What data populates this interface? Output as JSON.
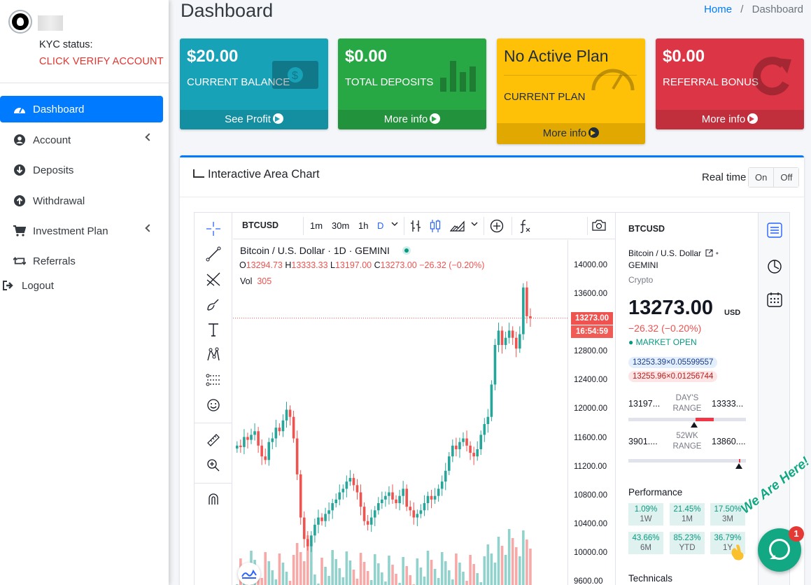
{
  "sidebar": {
    "kyc_label": "KYC status:",
    "kyc_link": "CLICK VERIFY ACCOUNT",
    "items": [
      {
        "label": "Dashboard"
      },
      {
        "label": "Account"
      },
      {
        "label": "Deposits"
      },
      {
        "label": "Withdrawal"
      },
      {
        "label": "Investment Plan"
      },
      {
        "label": "Referrals"
      },
      {
        "label": "Logout"
      }
    ]
  },
  "header": {
    "title": "Dashboard",
    "breadcrumb": [
      "Home",
      "/",
      "Dashboard"
    ]
  },
  "boxes": [
    {
      "value": "$20.00",
      "label": "CURRENT BALANCE",
      "footer": "See Profit",
      "color": "#17a2b8"
    },
    {
      "value": "$0.00",
      "label": "TOTAL DEPOSITS",
      "footer": "More info",
      "color": "#28a745"
    },
    {
      "value": "No Active Plan",
      "label": "CURRENT PLAN",
      "footer": "More info",
      "color": "#ffc107"
    },
    {
      "value": "$0.00",
      "label": "REFERRAL BONUS",
      "footer": "More info",
      "color": "#dc3545"
    }
  ],
  "card": {
    "title": "Interactive Area Chart",
    "realtime_label": "Real time",
    "on_label": "On",
    "off_label": "Off"
  },
  "tv": {
    "symbol": "BTCUSD",
    "intervals": [
      "1m",
      "30m",
      "1h",
      "D"
    ],
    "legend_title": "Bitcoin / U.S. Dollar · 1D · GEMINI",
    "ohlc": {
      "o_label": "O",
      "o": "13294.73",
      "h_label": "H",
      "h": "13333.33",
      "l_label": "L",
      "l": "13197.00",
      "c_label": "C",
      "c": "13273.00",
      "chg": "−26.32 (−0.20%)"
    },
    "vol_label": "Vol",
    "vol": "305",
    "price_ticks": [
      "14000.00",
      "13600.00",
      "13200.00",
      "12800.00",
      "12400.00",
      "12000.00",
      "11600.00",
      "11200.00",
      "10800.00",
      "10400.00",
      "10000.00",
      "9600.00"
    ],
    "last_price_tag": "13273.00",
    "countdown_tag": "16:54:59"
  },
  "symbol_info": {
    "symbol": "BTCUSD",
    "name": "Bitcoin / U.S. Dollar",
    "exchange": "GEMINI",
    "type": "Crypto",
    "price": "13273.00",
    "currency": "USD",
    "change": "−26.32 (−0.20%)",
    "market_status": "● MARKET OPEN",
    "bid": "13253.39×0.05599557",
    "ask": "13255.96×0.01256744",
    "days_range": {
      "low": "13197...",
      "label": "DAY'S RANGE",
      "high": "13333..."
    },
    "wk52_range": {
      "low": "3901....",
      "label": "52WK RANGE",
      "high": "13860...."
    },
    "performance_title": "Performance",
    "performance": [
      {
        "value": "1.09%",
        "period": "1W"
      },
      {
        "value": "21.45%",
        "period": "1M"
      },
      {
        "value": "17.50%",
        "period": "3M"
      },
      {
        "value": "43.66%",
        "period": "6M"
      },
      {
        "value": "85.23%",
        "period": "YTD"
      },
      {
        "value": "36.79%",
        "period": "1Y"
      }
    ],
    "technicals_title": "Technicals"
  },
  "chat": {
    "badge": "1",
    "bubble_text": "We Are Here!"
  },
  "chart_data": {
    "type": "candlestick",
    "title": "Bitcoin / U.S. Dollar · 1D · GEMINI",
    "ylim": [
      9600,
      14000
    ],
    "up_color": "#26a69a",
    "down_color": "#ef5350",
    "close": [
      11500,
      11480,
      11620,
      11580,
      11650,
      11700,
      11500,
      11350,
      11300,
      11550,
      11600,
      11750,
      11700,
      11850,
      12000,
      11900,
      11600,
      11100,
      10500,
      10200,
      10100,
      10250,
      10400,
      10500,
      10450,
      10550,
      10600,
      10700,
      10750,
      10850,
      10900,
      11000,
      11050,
      10950,
      10850,
      10650,
      10450,
      10400,
      10500,
      10600,
      10700,
      10750,
      10800,
      10850,
      10750,
      10700,
      10800,
      10900,
      10650,
      10600,
      10500,
      10550,
      10600,
      10700,
      10800,
      10750,
      10800,
      10900,
      11000,
      11150,
      11350,
      11500,
      11450,
      11550,
      11600,
      11500,
      11400,
      11350,
      11450,
      11650,
      11800,
      11900,
      12350,
      12900,
      13100,
      12900,
      13000,
      13100,
      13000,
      12850,
      13050,
      13700,
      13300,
      13273
    ]
  }
}
